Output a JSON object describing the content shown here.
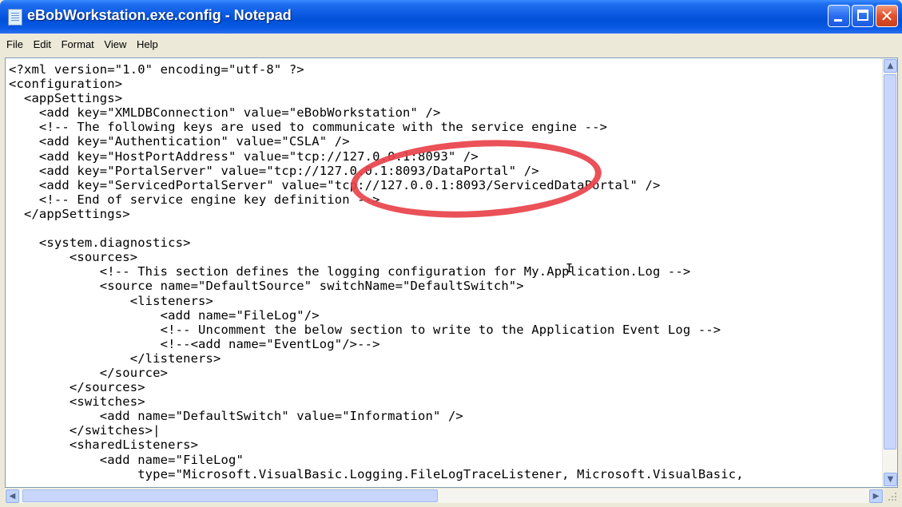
{
  "window": {
    "title": "eBobWorkstation.exe.config - Notepad",
    "icon": "notepad-icon"
  },
  "title_buttons": {
    "minimize": "minimize-icon",
    "maximize": "maximize-icon",
    "close_glyph": "✕"
  },
  "menu": [
    "File",
    "Edit",
    "Format",
    "View",
    "Help"
  ],
  "editor": {
    "text": "<?xml version=\"1.0\" encoding=\"utf-8\" ?>\n<configuration>\n  <appSettings>\n    <add key=\"XMLDBConnection\" value=\"eBobWorkstation\" />\n    <!-- The following keys are used to communicate with the service engine -->\n    <add key=\"Authentication\" value=\"CSLA\" />\n    <add key=\"HostPortAddress\" value=\"tcp://127.0.0.1:8093\" />\n    <add key=\"PortalServer\" value=\"tcp://127.0.0.1:8093/DataPortal\" />\n    <add key=\"ServicedPortalServer\" value=\"tcp://127.0.0.1:8093/ServicedDataPortal\" />\n    <!-- End of service engine key definition -->\n  </appSettings>\n\n    <system.diagnostics>\n        <sources>\n            <!-- This section defines the logging configuration for My.Application.Log -->\n            <source name=\"DefaultSource\" switchName=\"DefaultSwitch\">\n                <listeners>\n                    <add name=\"FileLog\"/>\n                    <!-- Uncomment the below section to write to the Application Event Log -->\n                    <!--<add name=\"EventLog\"/>-->\n                </listeners>\n            </source>\n        </sources>\n        <switches>\n            <add name=\"DefaultSwitch\" value=\"Information\" />\n        </switches>|\n        <sharedListeners>\n            <add name=\"FileLog\"\n                 type=\"Microsoft.VisualBasic.Logging.FileLogTraceListener, Microsoft.VisualBasic,"
  },
  "scrollbars": {
    "up": "▲",
    "down": "▼",
    "left": "◀",
    "right": "▶",
    "grip": "size-grip-icon"
  },
  "annotation": {
    "color": "#e8424a",
    "shape": "red-ellipse-highlight"
  }
}
